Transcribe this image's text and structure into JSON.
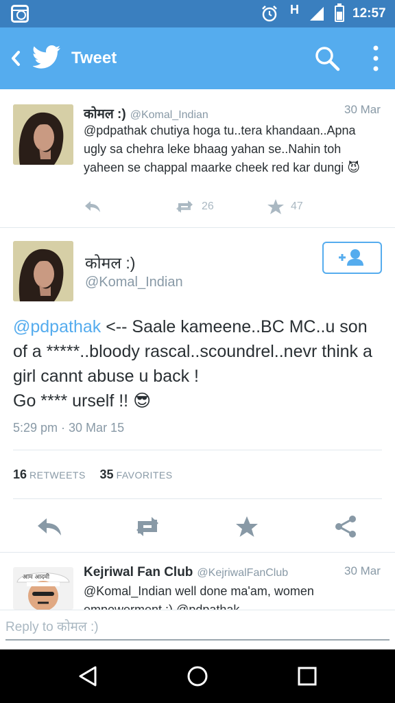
{
  "status_bar": {
    "network": "H",
    "time": "12:57"
  },
  "app_bar": {
    "title": "Tweet"
  },
  "tweets": [
    {
      "name": "कोमल :)",
      "handle": "@Komal_Indian",
      "date": "30 Mar",
      "text": "@pdpathak chutiya hoga tu..tera khandaan..Apna ugly sa chehra leke bhaag yahan se..Nahin toh yaheen se chappal maarke cheek red kar dungi",
      "emoji": "😈",
      "retweets": "26",
      "favorites": "47"
    }
  ],
  "main_tweet": {
    "name": "कोमल :)",
    "handle": "@Komal_Indian",
    "mention": "@pdpathak",
    "text_line1": " <-- Saale kameene..BC MC..u son of a *****..bloody rascal..scoundrel..nevr think a girl cannt abuse u back !",
    "text_line2": "Go **** urself !! ",
    "emoji": "😎",
    "timestamp": "5:29 pm · 30 Mar 15",
    "retweets_count": "16",
    "retweets_label": "RETWEETS",
    "favorites_count": "35",
    "favorites_label": "FAVORITES"
  },
  "reply_tweet": {
    "name": "Kejriwal Fan Club",
    "handle": "@KejriwalFanClub",
    "date": "30 Mar",
    "text": "@Komal_Indian well done ma'am, women empowerment :) @pdpathak"
  },
  "reply_bar": {
    "placeholder": "Reply to कोमल :)"
  },
  "colors": {
    "brand": "#55acee",
    "status_bar": "#3a7fbf",
    "muted": "#8899a6",
    "text": "#292f33"
  }
}
